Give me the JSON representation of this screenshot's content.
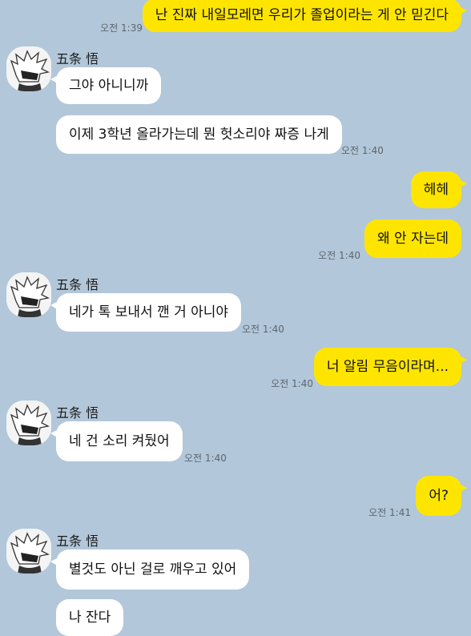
{
  "contact": {
    "name": "五条 悟"
  },
  "messages": [
    {
      "from": "me",
      "text": "난 진짜 내일모레면 우리가 졸업이라는 게 안 믿긴다",
      "time": "오전 1:39"
    },
    {
      "from": "them",
      "text": "그야 아니니까"
    },
    {
      "from": "them",
      "text": "이제 3학년 올라가는데 뭔 헛소리야 짜증 나게",
      "time": "오전 1:40"
    },
    {
      "from": "me",
      "text": "헤헤"
    },
    {
      "from": "me",
      "text": "왜 안 자는데",
      "time": "오전 1:40"
    },
    {
      "from": "them",
      "text": "네가 톡 보내서 깬 거 아니야",
      "time": "오전 1:40"
    },
    {
      "from": "me",
      "text": "너 알림 무음이라며...",
      "time": "오전 1:40"
    },
    {
      "from": "them",
      "text": "네 건 소리 켜뒀어",
      "time": "오전 1:40"
    },
    {
      "from": "me",
      "text": "어?",
      "time": "오전 1:41"
    },
    {
      "from": "them",
      "text": "별것도 아닌 걸로 깨우고 있어"
    },
    {
      "from": "them",
      "text": "나 잔다"
    }
  ],
  "colors": {
    "background": "#b2c7d9",
    "my_bubble": "#fee500",
    "their_bubble": "#ffffff"
  },
  "icons": {
    "avatar": "white-haired-character-avatar-icon"
  }
}
